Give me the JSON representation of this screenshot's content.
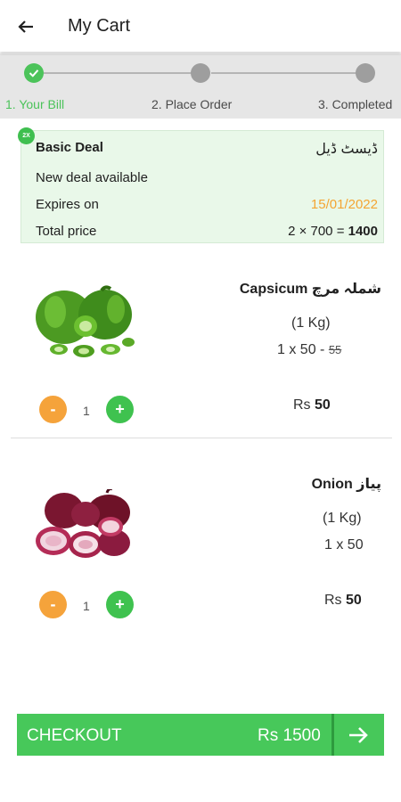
{
  "appbar": {
    "title": "My Cart",
    "back_icon": "arrow-left-icon"
  },
  "stepper": {
    "steps": [
      {
        "label": "1. Your Bill",
        "state": "done"
      },
      {
        "label": "2. Place Order",
        "state": "pending"
      },
      {
        "label": "3. Completed",
        "state": "pending"
      }
    ],
    "colors": {
      "done": "#4cc35a",
      "pending": "#9e9e9e"
    }
  },
  "deal": {
    "badge": "2X",
    "title": "Basic Deal",
    "title_urdu": "ڈیسٹ ڈیل",
    "subtitle": "New deal available",
    "expires_label": "Expires on",
    "expires_value": "15/01/2022",
    "total_label": "Total price",
    "total_formula": "2 × 700 = ",
    "total_value": "1400"
  },
  "items": [
    {
      "name": "Capsicum شملہ مرچ",
      "weight": "(1 Kg)",
      "qty_price": "1 x 50 - ",
      "old_price": "55",
      "quantity": "1",
      "currency": "Rs ",
      "total": "50",
      "image_icon": "capsicum-image"
    },
    {
      "name": "Onion پیاز",
      "weight": "(1 Kg)",
      "qty_price": "1 x 50",
      "old_price": "",
      "quantity": "1",
      "currency": "Rs ",
      "total": "50",
      "image_icon": "onion-image"
    }
  ],
  "qty_controls": {
    "minus": "-",
    "plus": "+",
    "minus_color": "#f5a33b",
    "plus_color": "#3fc24f"
  },
  "checkout": {
    "label": "CHECKOUT",
    "total": "Rs 1500",
    "arrow_icon": "arrow-right-icon",
    "color": "#47c85a"
  }
}
